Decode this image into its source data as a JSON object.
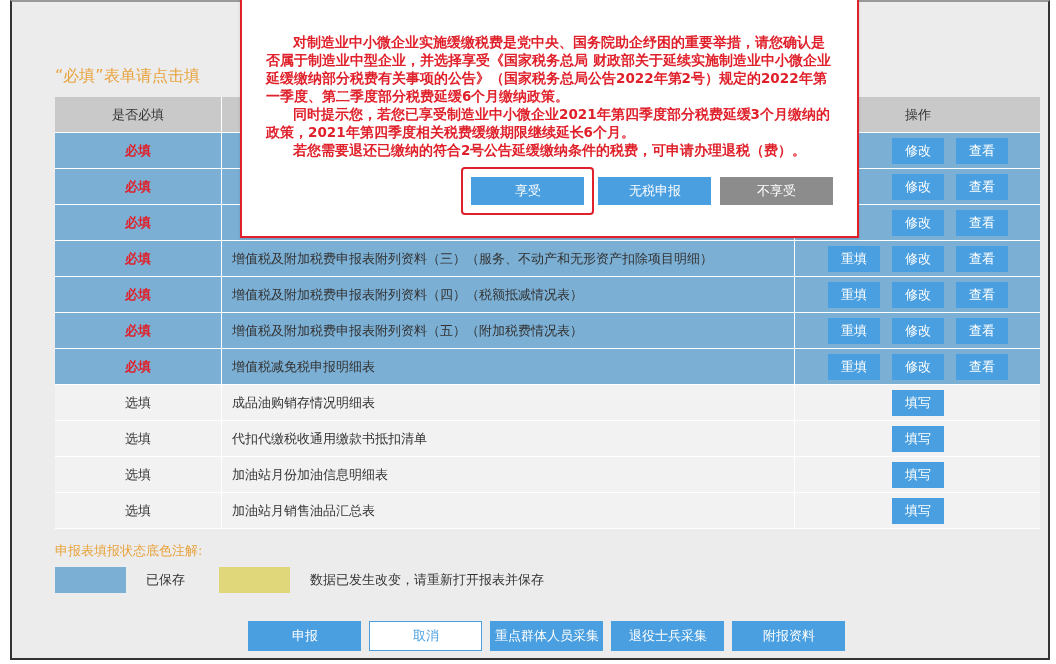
{
  "hint": "“必填”表单请点击填",
  "table": {
    "header_first": "是否必填",
    "header_last": "操作",
    "rows": [
      {
        "kind": "required",
        "label": "必填",
        "saved": true,
        "buttons": [
          "修改",
          "查看"
        ]
      },
      {
        "kind": "required",
        "label": "必填",
        "saved": true,
        "buttons": [
          "修改",
          "查看"
        ]
      },
      {
        "kind": "required",
        "label": "必填",
        "saved": true,
        "buttons": [
          "修改",
          "查看"
        ]
      },
      {
        "kind": "required",
        "label": "必填",
        "saved": true,
        "name": "增值税及附加税费申报表附列资料（三）（服务、不动产和无形资产扣除项目明细）",
        "buttons": [
          "重填",
          "修改",
          "查看"
        ]
      },
      {
        "kind": "required",
        "label": "必填",
        "saved": true,
        "name": "增值税及附加税费申报表附列资料（四）（税额抵减情况表）",
        "buttons": [
          "重填",
          "修改",
          "查看"
        ]
      },
      {
        "kind": "required",
        "label": "必填",
        "saved": true,
        "name": "增值税及附加税费申报表附列资料（五）（附加税费情况表）",
        "buttons": [
          "重填",
          "修改",
          "查看"
        ]
      },
      {
        "kind": "required",
        "label": "必填",
        "saved": true,
        "name": "增值税减免税申报明细表",
        "buttons": [
          "重填",
          "修改",
          "查看"
        ]
      },
      {
        "kind": "optional",
        "label": "选填",
        "saved": false,
        "name": "成品油购销存情况明细表",
        "buttons": [
          "填写"
        ]
      },
      {
        "kind": "optional",
        "label": "选填",
        "saved": false,
        "name": "代扣代缴税收通用缴款书抵扣清单",
        "buttons": [
          "填写"
        ]
      },
      {
        "kind": "optional",
        "label": "选填",
        "saved": false,
        "name": "加油站月份加油信息明细表",
        "buttons": [
          "填写"
        ]
      },
      {
        "kind": "optional",
        "label": "选填",
        "saved": false,
        "name": "加油站月销售油品汇总表",
        "buttons": [
          "填写"
        ]
      }
    ]
  },
  "legend": {
    "title": "申报表填报状态底色注解:",
    "items": [
      {
        "color": "#7bafd4",
        "label": "已保存"
      },
      {
        "color": "#e0d67a",
        "label": "数据已发生改变，请重新打开报表并保存"
      }
    ]
  },
  "actions": [
    {
      "label": "申报",
      "kind": "primary"
    },
    {
      "label": "取消",
      "kind": "outline"
    },
    {
      "label": "重点群体人员采集",
      "kind": "primary"
    },
    {
      "label": "退役士兵采集",
      "kind": "primary"
    },
    {
      "label": "附报资料",
      "kind": "primary"
    }
  ],
  "dialog": {
    "paragraphs": [
      "对制造业中小微企业实施缓缴税费是党中央、国务院助企纾困的重要举措，请您确认是否属于制造业中型企业，并选择享受《国家税务总局 财政部关于延续实施制造业中小微企业延缓缴纳部分税费有关事项的公告》（国家税务总局公告2022年第2号）规定的2022年第一季度、第二季度部分税费延缓6个月缴纳政策。",
      "同时提示您，若您已享受制造业中小微企业2021年第四季度部分税费延缓3个月缴纳的政策，2021年第四季度相关税费缓缴期限继续延长6个月。",
      "若您需要退还已缴纳的符合2号公告延缓缴纳条件的税费，可申请办理退税（费）。"
    ],
    "buttons": [
      {
        "label": "享受",
        "kind": "primary",
        "highlighted": true
      },
      {
        "label": "无税申报",
        "kind": "primary",
        "highlighted": false
      },
      {
        "label": "不享受",
        "kind": "gray",
        "highlighted": false
      }
    ]
  }
}
